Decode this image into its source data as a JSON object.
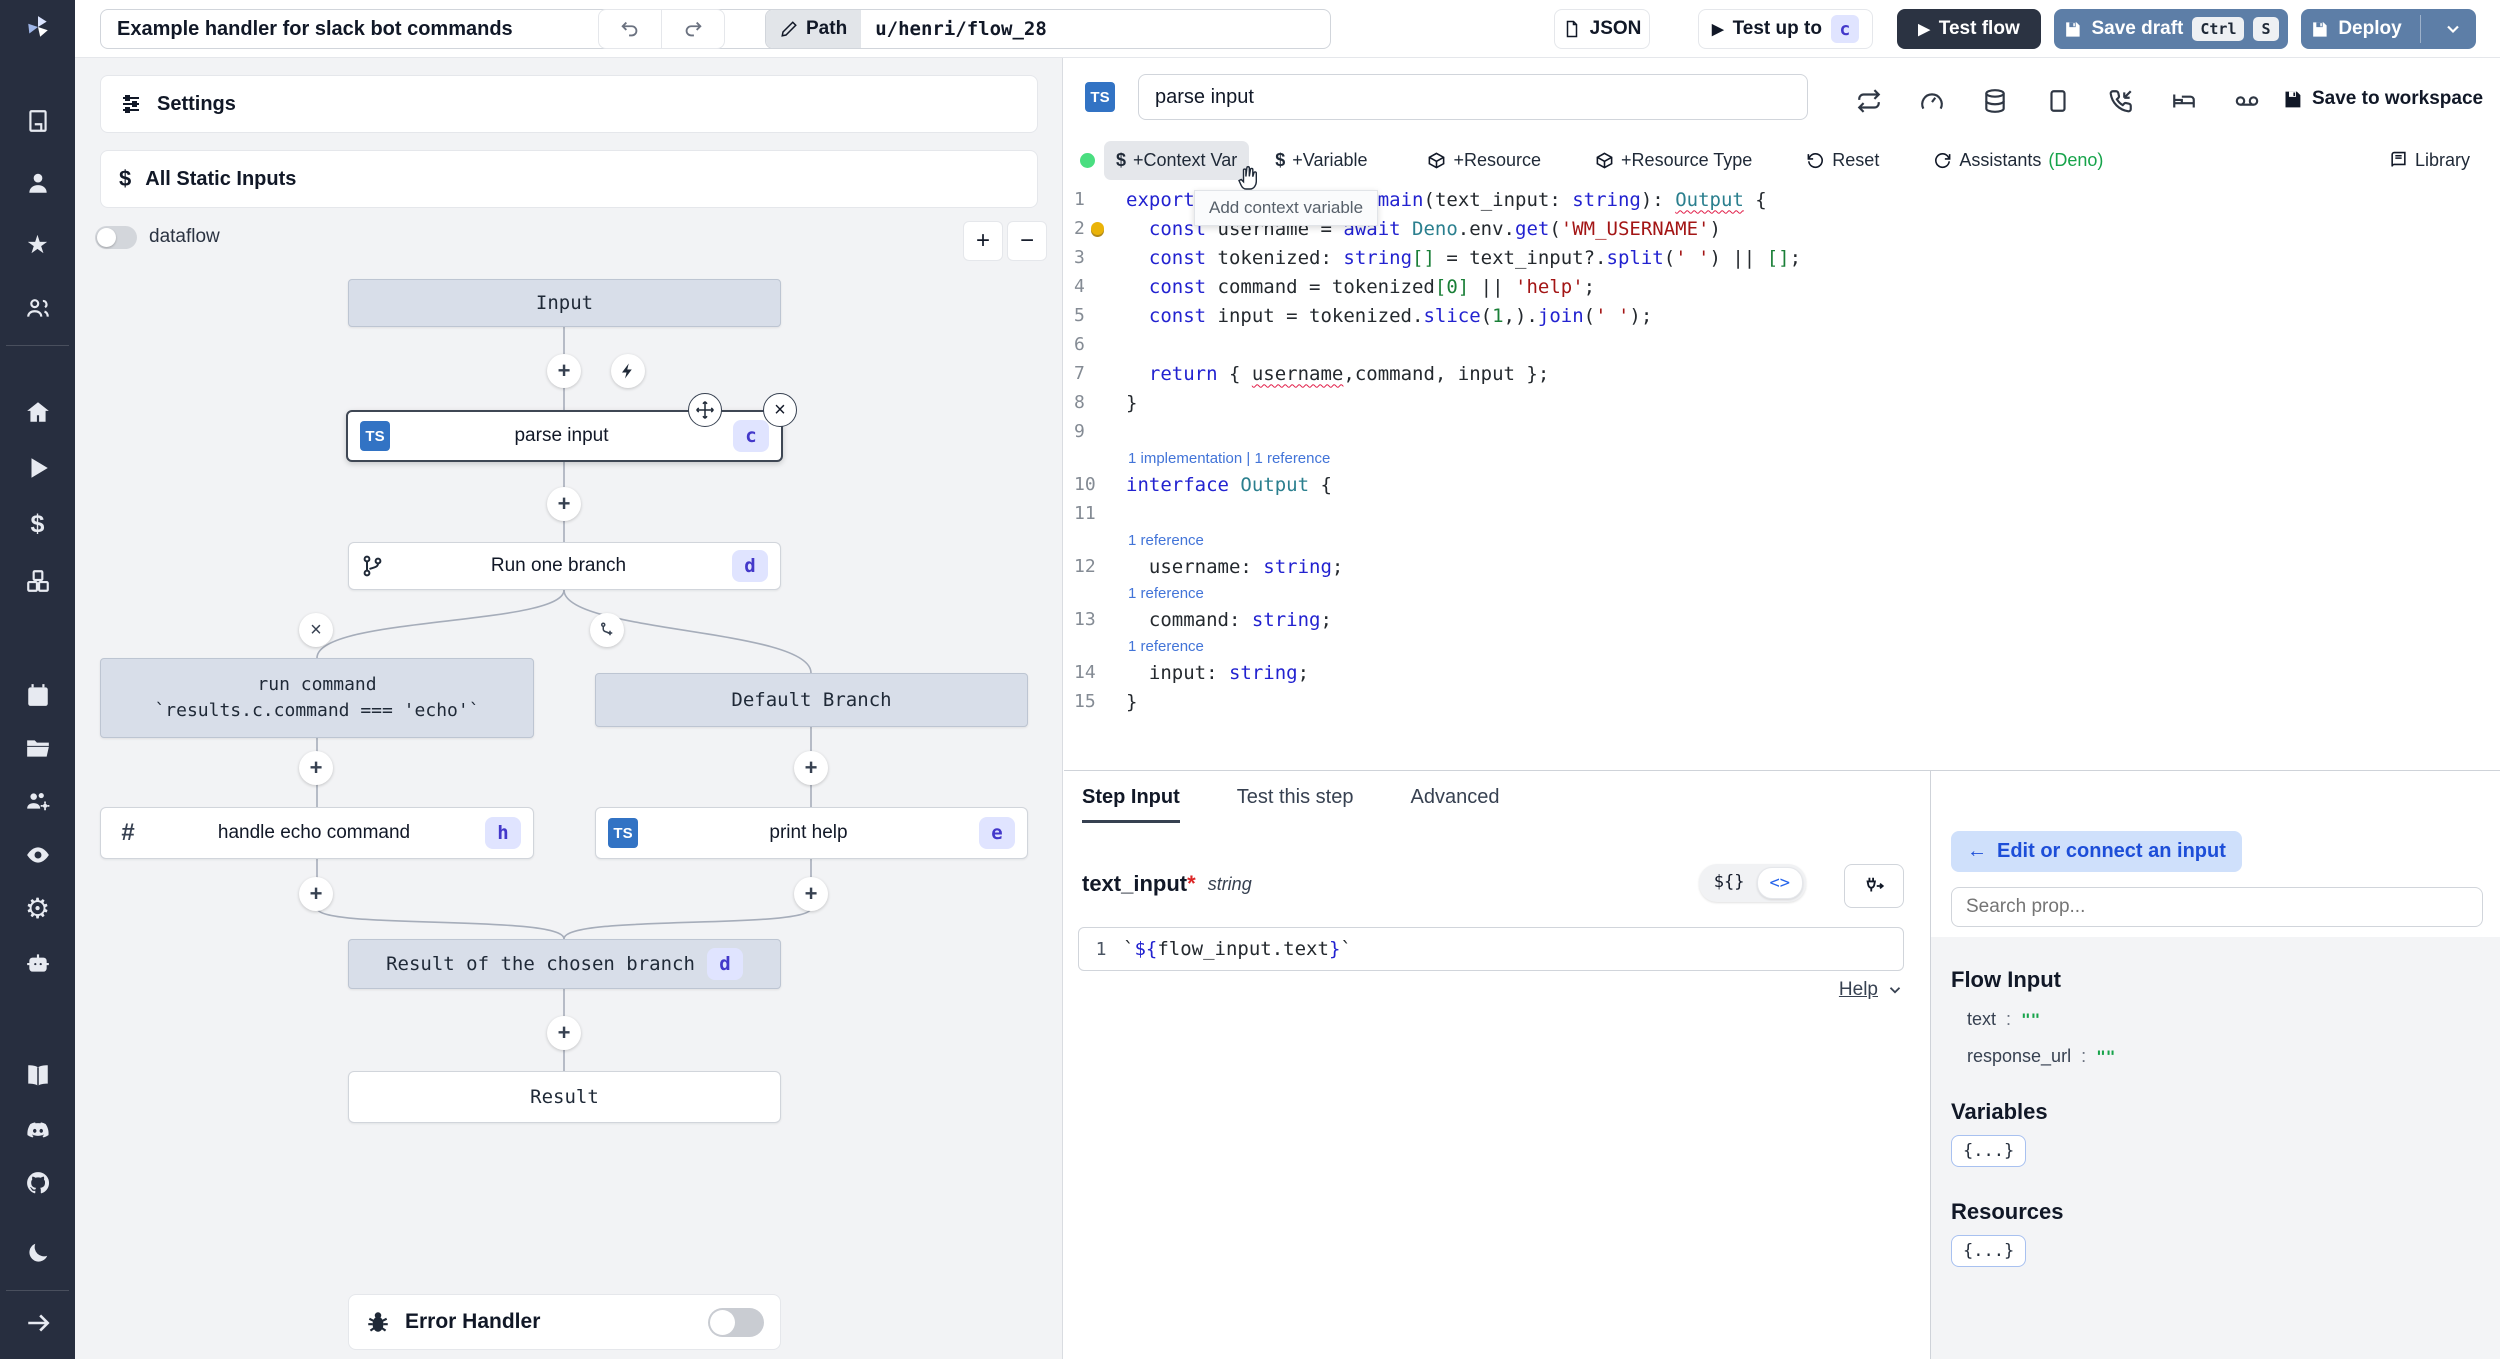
{
  "topbar": {
    "title": "Example handler for slack bot commands",
    "path_label": "Path",
    "path_value": "u/henri/flow_28",
    "json_label": "JSON",
    "test_up_to_label": "Test up to",
    "test_up_to_badge": "c",
    "test_flow_label": "Test flow",
    "save_draft_label": "Save draft",
    "save_keys": [
      "Ctrl",
      "S"
    ],
    "deploy_label": "Deploy"
  },
  "flow": {
    "settings_label": "Settings",
    "static_inputs_label": "All Static Inputs",
    "static_inputs_icon": "$",
    "dataflow_label": "dataflow",
    "zoom_in": "+",
    "zoom_out": "−",
    "nodes": {
      "input": {
        "label": "Input"
      },
      "parse_input": {
        "label": "parse input",
        "badge": "c",
        "lang": "TS"
      },
      "run_one_branch": {
        "label": "Run one branch",
        "badge": "d"
      },
      "run_command": {
        "line1": "run command",
        "line2": "`results.c.command === 'echo'`"
      },
      "default_branch": {
        "label": "Default Branch"
      },
      "handle_echo": {
        "label": "handle echo command",
        "badge": "h",
        "icon": "#"
      },
      "print_help": {
        "label": "print help",
        "badge": "e",
        "lang": "TS"
      },
      "result_chosen": {
        "label": "Result of the chosen branch",
        "badge": "d"
      },
      "result": {
        "label": "Result"
      }
    },
    "error_handler_label": "Error Handler"
  },
  "editor": {
    "step_name": "parse input",
    "save_to_workspace": "Save to workspace",
    "toolbar": {
      "context_var": "+Context Var",
      "context_var_icon": "$",
      "variable": "+Variable",
      "variable_icon": "$",
      "resource": "+Resource",
      "resource_type": "+Resource Type",
      "reset": "Reset",
      "assistants": "Assistants",
      "assistants_lang": "(Deno)",
      "library": "Library"
    },
    "tooltip": "Add context variable",
    "code": {
      "rows": [
        {
          "num": "1",
          "t": [
            [
              "k",
              "export"
            ],
            [
              "d",
              " "
            ],
            [
              "k",
              "async"
            ],
            [
              "d",
              " "
            ],
            [
              "k",
              "function"
            ],
            [
              "d",
              " "
            ],
            [
              "k",
              "main"
            ],
            [
              "d",
              "("
            ],
            [
              "d",
              "text_input"
            ],
            [
              "d",
              ": "
            ],
            [
              "k",
              "string"
            ],
            [
              "d",
              "): "
            ],
            [
              "tq",
              "Output"
            ],
            [
              "d",
              " {"
            ]
          ]
        },
        {
          "num": "2",
          "bulb": true,
          "t": [
            [
              "d",
              "  "
            ],
            [
              "k",
              "const"
            ],
            [
              "d",
              " username = "
            ],
            [
              "k",
              "await"
            ],
            [
              "d",
              " "
            ],
            [
              "t",
              "Deno"
            ],
            [
              "d",
              ".env."
            ],
            [
              "k",
              "get"
            ],
            [
              "d",
              "("
            ],
            [
              "s",
              "'WM_USERNAME'"
            ],
            [
              "d",
              ")"
            ]
          ]
        },
        {
          "num": "3",
          "t": [
            [
              "d",
              "  "
            ],
            [
              "k",
              "const"
            ],
            [
              "d",
              " tokenized: "
            ],
            [
              "k",
              "string"
            ],
            [
              "n",
              "[]"
            ],
            [
              "d",
              " = text_input?."
            ],
            [
              "k",
              "split"
            ],
            [
              "d",
              "("
            ],
            [
              "s",
              "' '"
            ],
            [
              "d",
              ") || "
            ],
            [
              "n",
              "[]"
            ],
            [
              "d",
              ";"
            ]
          ]
        },
        {
          "num": "4",
          "t": [
            [
              "d",
              "  "
            ],
            [
              "k",
              "const"
            ],
            [
              "d",
              " command = tokenized"
            ],
            [
              "n",
              "["
            ],
            [
              "n",
              "0"
            ],
            [
              "n",
              "]"
            ],
            [
              "d",
              " || "
            ],
            [
              "s",
              "'help'"
            ],
            [
              "d",
              ";"
            ]
          ]
        },
        {
          "num": "5",
          "t": [
            [
              "d",
              "  "
            ],
            [
              "k",
              "const"
            ],
            [
              "d",
              " input = tokenized."
            ],
            [
              "k",
              "slice"
            ],
            [
              "d",
              "("
            ],
            [
              "n",
              "1"
            ],
            [
              "d",
              ",)."
            ],
            [
              "k",
              "join"
            ],
            [
              "d",
              "("
            ],
            [
              "s",
              "' '"
            ],
            [
              "d",
              ");"
            ]
          ]
        },
        {
          "num": "6",
          "t": []
        },
        {
          "num": "7",
          "t": [
            [
              "d",
              "  "
            ],
            [
              "k",
              "return"
            ],
            [
              "d",
              " { "
            ],
            [
              "dq",
              "username"
            ],
            [
              "d",
              ",command, input };"
            ]
          ]
        },
        {
          "num": "8",
          "t": [
            [
              "d",
              "}"
            ]
          ]
        },
        {
          "num": "9",
          "t": []
        },
        {
          "lens": "1 implementation | 1 reference"
        },
        {
          "num": "10",
          "t": [
            [
              "k",
              "interface"
            ],
            [
              "d",
              " "
            ],
            [
              "t",
              "Output"
            ],
            [
              "d",
              " {"
            ]
          ]
        },
        {
          "num": "11",
          "t": []
        },
        {
          "lens": "1 reference"
        },
        {
          "num": "12",
          "t": [
            [
              "d",
              "  username: "
            ],
            [
              "k",
              "string"
            ],
            [
              "d",
              ";"
            ]
          ]
        },
        {
          "lens": "1 reference"
        },
        {
          "num": "13",
          "t": [
            [
              "d",
              "  command: "
            ],
            [
              "k",
              "string"
            ],
            [
              "d",
              ";"
            ]
          ]
        },
        {
          "lens": "1 reference"
        },
        {
          "num": "14",
          "t": [
            [
              "d",
              "  input: "
            ],
            [
              "k",
              "string"
            ],
            [
              "d",
              ";"
            ]
          ]
        },
        {
          "num": "15",
          "t": [
            [
              "d",
              "}"
            ]
          ]
        }
      ]
    }
  },
  "step_panel": {
    "tabs": [
      "Step Input",
      "Test this step",
      "Advanced"
    ],
    "field_name": "text_input",
    "field_required": "*",
    "field_type": "string",
    "expr_gutter": "1",
    "seg_template": "${}",
    "seg_code": "<>",
    "expr_tokens": [
      [
        "d",
        "`"
      ],
      [
        "k",
        "${"
      ],
      [
        "d",
        "flow_input.text"
      ],
      [
        "k",
        "}"
      ],
      [
        "d",
        "`"
      ]
    ],
    "help_label": "Help"
  },
  "props_panel": {
    "edit_connect_label": "Edit or connect an input",
    "back_arrow": "←",
    "search_placeholder": "Search prop...",
    "flow_input_title": "Flow Input",
    "props": [
      {
        "key": "text",
        "sep": ":",
        "value": "\"\""
      },
      {
        "key": "response_url",
        "sep": ":",
        "value": "\"\""
      }
    ],
    "variables_title": "Variables",
    "variables_chip": "{...}",
    "resources_title": "Resources",
    "resources_chip": "{...}"
  }
}
